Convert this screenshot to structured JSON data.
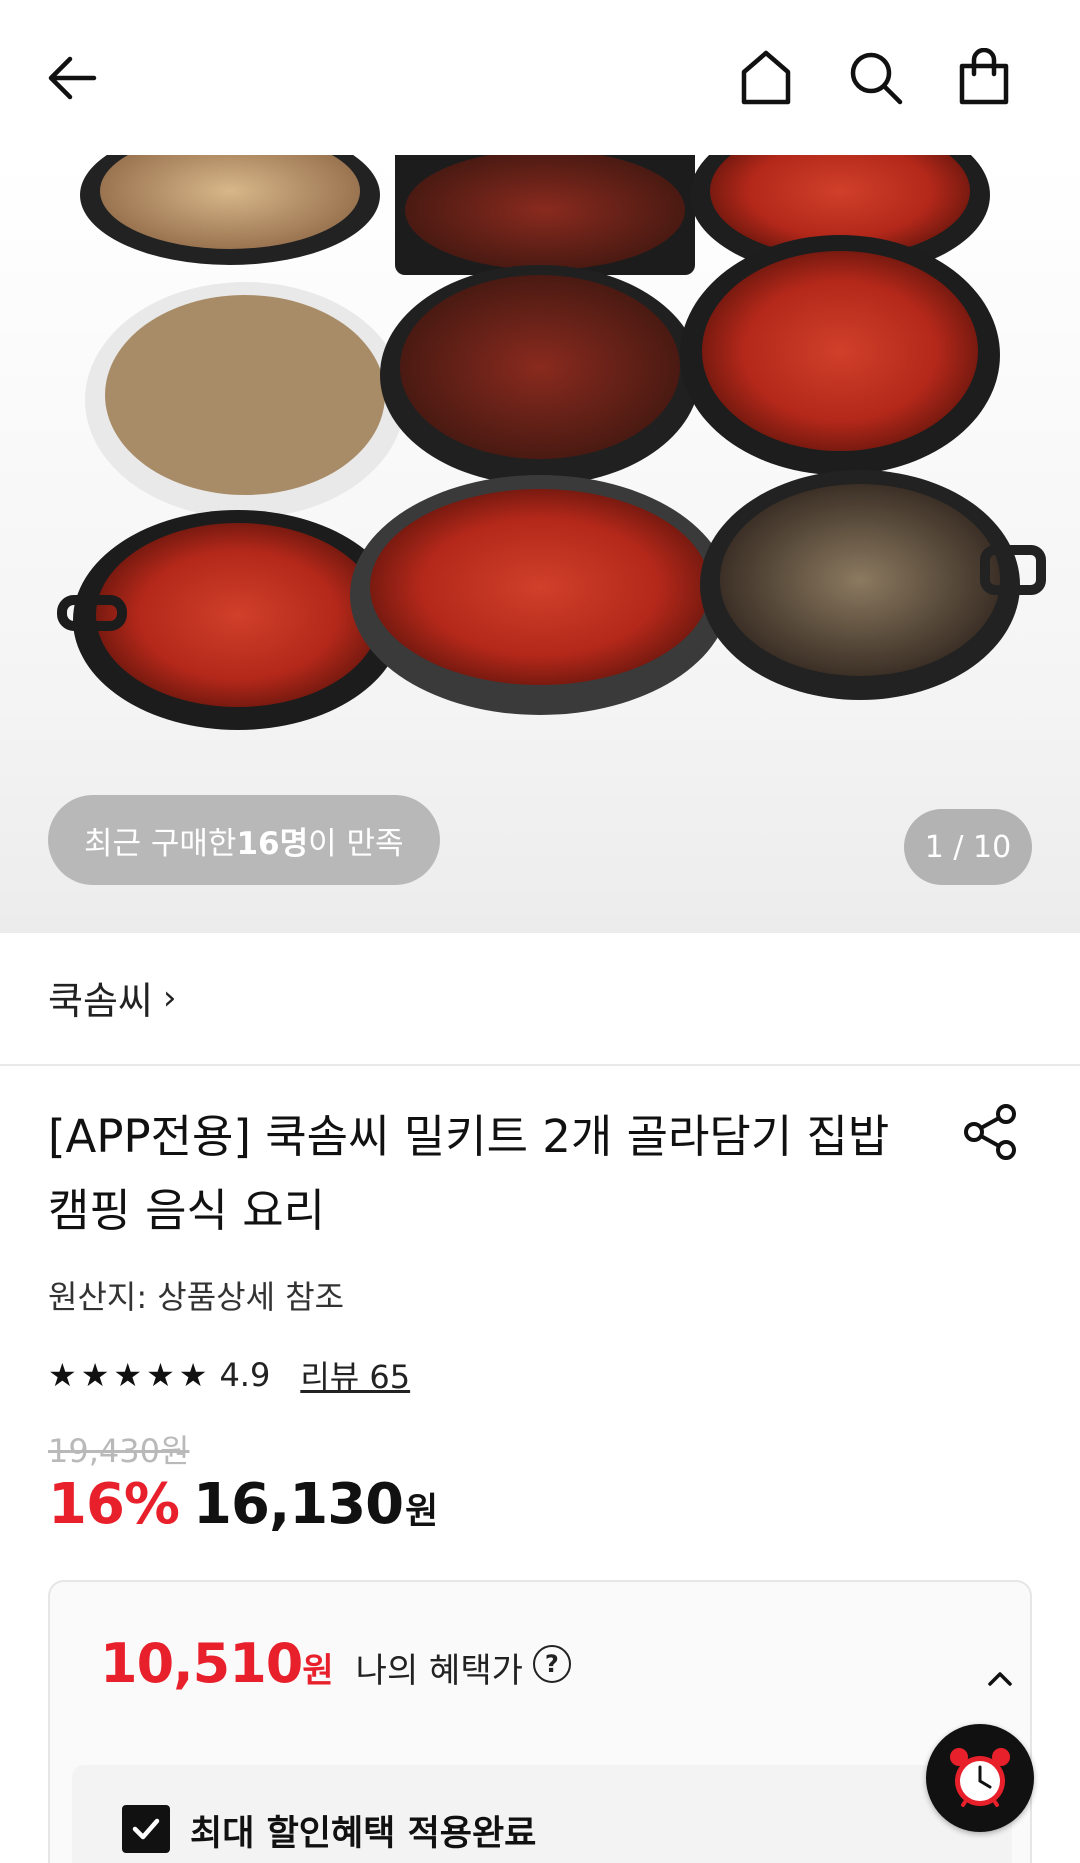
{
  "header": {
    "back_icon": "arrow-left-icon",
    "home_icon": "home-icon",
    "search_icon": "search-icon",
    "cart_icon": "shopping-bag-icon"
  },
  "gallery": {
    "satisfaction_prefix": "최근 구매한 ",
    "satisfaction_count": "16명",
    "satisfaction_suffix": "이 만족",
    "page_indicator": "1 / 10"
  },
  "seller": {
    "name": "쿡솜씨",
    "chevron": "›"
  },
  "product": {
    "title": "[APP전용] 쿡솜씨 밀키트 2개 골라담기 집밥 캠핑 음식 요리",
    "origin": "원산지: 상품상세 참조",
    "rating": "4.9",
    "rating_stars": 5,
    "reviews": "리뷰 65",
    "original_price": "19,430원",
    "discount": "16%",
    "price": "16,130",
    "price_unit": "원"
  },
  "benefit": {
    "price": "10,510",
    "price_unit": "원",
    "label": "나의 혜택가",
    "help_symbol": "?",
    "applied_text": "최대 할인혜택 적용완료",
    "checked": true
  },
  "fab": {
    "icon": "alarm-clock-icon"
  },
  "colors": {
    "accent_red": "#e8202b",
    "badge_gray": "#b8b8b8"
  }
}
